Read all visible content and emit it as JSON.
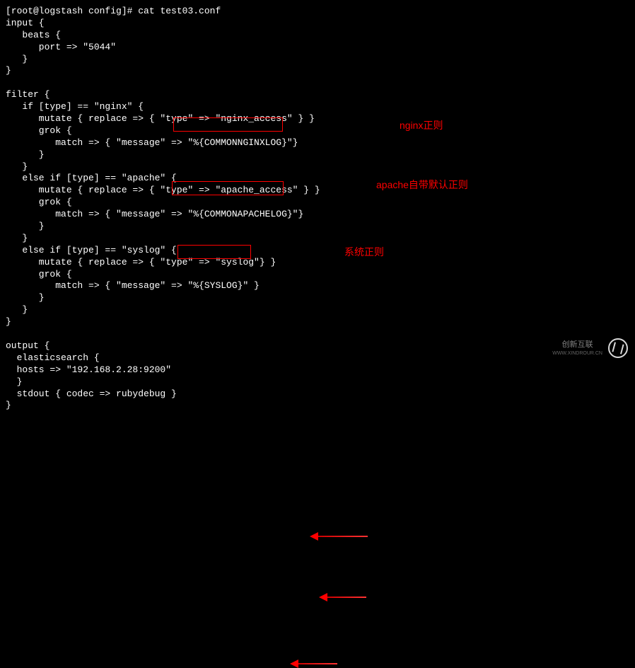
{
  "terminal": {
    "prompt": "[root@logstash config]# ",
    "command": "cat test03.conf",
    "lines": [
      "input {",
      "   beats {",
      "      port => \"5044\"",
      "   }",
      "}",
      "",
      "filter {",
      "   if [type] == \"nginx\" {",
      "      mutate { replace => { \"type\" => \"nginx_access\" } }",
      "      grok {",
      "         match => { \"message\" => \"%{COMMONNGINXLOG}\"}",
      "      }",
      "   }",
      "   else if [type] == \"apache\" {",
      "      mutate { replace => { \"type\" => \"apache_access\" } }",
      "      grok {",
      "         match => { \"message\" => \"%{COMMONAPACHELOG}\"}",
      "      }",
      "   }",
      "   else if [type] == \"syslog\" {",
      "      mutate { replace => { \"type\" => \"syslog\"} }",
      "      grok {",
      "         match => { \"message\" => \"%{SYSLOG}\" }",
      "      }",
      "   }",
      "}",
      "",
      "output {",
      "  elasticsearch {",
      "  hosts => \"192.168.2.28:9200\"",
      "  }",
      "  stdout { codec => rubydebug }",
      "}"
    ]
  },
  "annotations": {
    "nginx": "nginx正则",
    "apache": "apache自带默认正则",
    "syslog": "系统正则"
  },
  "highlights": {
    "nginx_pattern": "\"%{COMMONNGINXLOG}\"}",
    "apache_pattern": "\"%{COMMONAPACHELOG}\"}",
    "syslog_pattern": "\"%{SYSLOG}\" }"
  },
  "watermark": {
    "brand": "创新互联",
    "url": "WWW.XINDROUR.CN"
  }
}
